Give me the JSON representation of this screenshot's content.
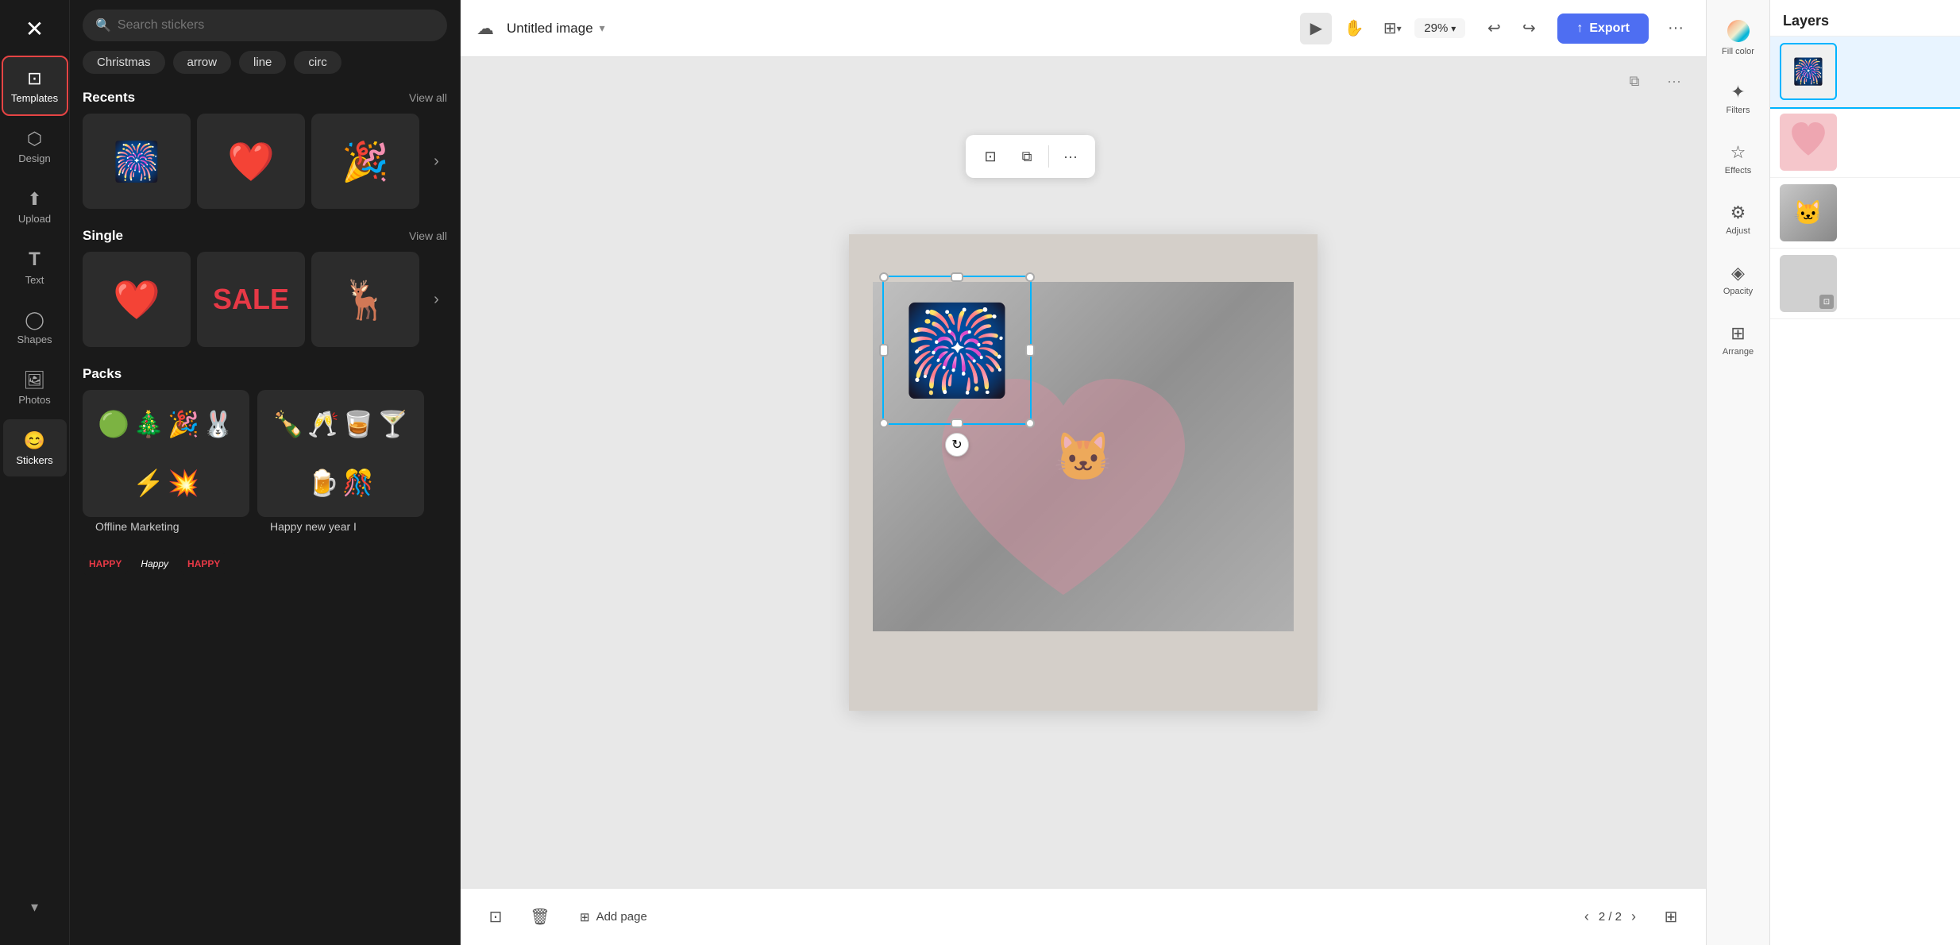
{
  "app": {
    "logo": "✕",
    "title": "Untitled image",
    "title_caret": "▾"
  },
  "sidebar": {
    "items": [
      {
        "id": "templates",
        "label": "Templates",
        "icon": "⊡"
      },
      {
        "id": "design",
        "label": "Design",
        "icon": "⬡"
      },
      {
        "id": "upload",
        "label": "Upload",
        "icon": "⬆"
      },
      {
        "id": "text",
        "label": "Text",
        "icon": "T"
      },
      {
        "id": "shapes",
        "label": "Shapes",
        "icon": "◯"
      },
      {
        "id": "photos",
        "label": "Photos",
        "icon": "🖼"
      },
      {
        "id": "stickers",
        "label": "Stickers",
        "icon": "😊"
      }
    ]
  },
  "sticker_panel": {
    "search_placeholder": "Search stickers",
    "tags": [
      "Christmas",
      "arrow",
      "line",
      "circ"
    ],
    "recents_label": "Recents",
    "view_all_label": "View all",
    "single_label": "Single",
    "packs_label": "Packs",
    "pack_items": [
      {
        "name": "Offline Marketing",
        "emojis": [
          "🟢",
          "🎄",
          "🎉",
          "🐰",
          "⚡",
          "💥"
        ]
      },
      {
        "name": "Happy new year I",
        "emojis": [
          "🍾",
          "🥂",
          "🍸",
          "🥃",
          "🍺",
          "🎊"
        ]
      }
    ]
  },
  "toolbar": {
    "zoom": "29%",
    "export_label": "Export",
    "undo_icon": "↩",
    "redo_icon": "↪"
  },
  "float_toolbar": {
    "crop_icon": "⊡",
    "copy_icon": "⧉",
    "more_icon": "···"
  },
  "canvas": {
    "page_info": "2 / 2",
    "page_icon_prev": "‹",
    "page_icon_next": "›"
  },
  "bottom_bar": {
    "add_page_label": "Add page"
  },
  "right_tools": [
    {
      "id": "fill-color",
      "label": "Fill color",
      "icon": "fill"
    },
    {
      "id": "filters",
      "label": "Filters",
      "icon": "✦"
    },
    {
      "id": "effects",
      "label": "Effects",
      "icon": "☆"
    },
    {
      "id": "adjust",
      "label": "Adjust",
      "icon": "⚙"
    },
    {
      "id": "opacity",
      "label": "Opacity",
      "icon": "◈"
    },
    {
      "id": "arrange",
      "label": "Arrange",
      "icon": "⊞"
    }
  ],
  "layers": {
    "title": "Layers",
    "items": [
      {
        "id": "firework",
        "type": "sticker",
        "icon": "🎆",
        "selected": true
      },
      {
        "id": "heart",
        "type": "heart"
      },
      {
        "id": "cat",
        "type": "photo"
      },
      {
        "id": "bg",
        "type": "background"
      }
    ]
  }
}
